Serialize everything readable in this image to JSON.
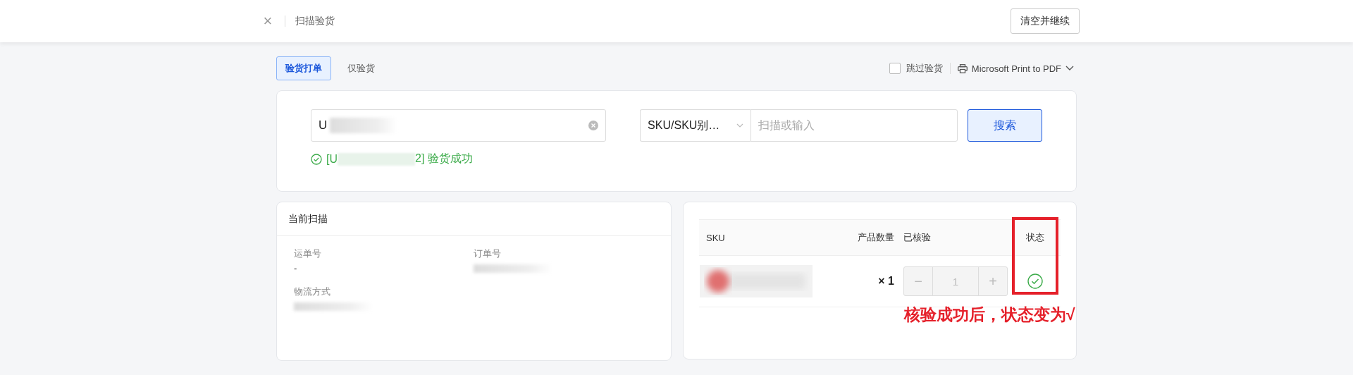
{
  "header": {
    "close": "×",
    "title": "扫描验货",
    "action": "清空并继续"
  },
  "tabs": [
    {
      "label": "验货打单",
      "selected": true
    },
    {
      "label": "仅验货",
      "selected": false
    }
  ],
  "skip_check": {
    "label": "跳过验货",
    "checked": false
  },
  "printer": {
    "label": "Microsoft Print to PDF"
  },
  "search": {
    "value": "U",
    "select": "SKU/SKU别…",
    "placeholder": "扫描或输入",
    "button": "搜索",
    "message_prefix": "[U",
    "message_suffix": "2] 验货成功"
  },
  "current_scan": {
    "title": "当前扫描",
    "fields": [
      {
        "label": "运单号",
        "value": "-"
      },
      {
        "label": "订单号",
        "redacted": true
      },
      {
        "label": "物流方式",
        "redacted": true
      }
    ]
  },
  "table": {
    "columns": [
      "SKU",
      "产品数量",
      "已核验",
      "状态"
    ],
    "rows": [
      {
        "quantity": "× 1",
        "stepper": {
          "minus": "−",
          "value": "1",
          "plus": "+"
        },
        "verified": true
      }
    ]
  },
  "annotation": "核验成功后，状态变为√"
}
